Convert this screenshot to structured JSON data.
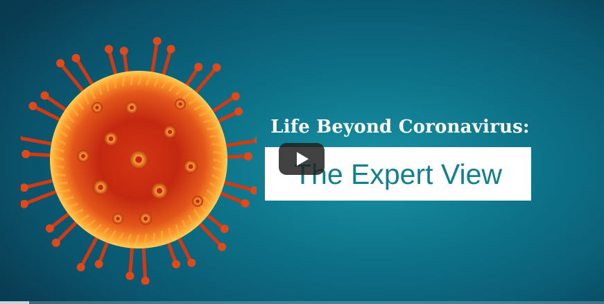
{
  "video": {
    "title": "Life Beyond Coronavirus:",
    "subtitle": "The Expert View",
    "play_icon": "play-icon",
    "progress": 0.048
  },
  "colors": {
    "background": "#0d7288",
    "subtitle_text": "#127f8f",
    "virus_core": "#c42810",
    "virus_glow": "#ffb938"
  }
}
